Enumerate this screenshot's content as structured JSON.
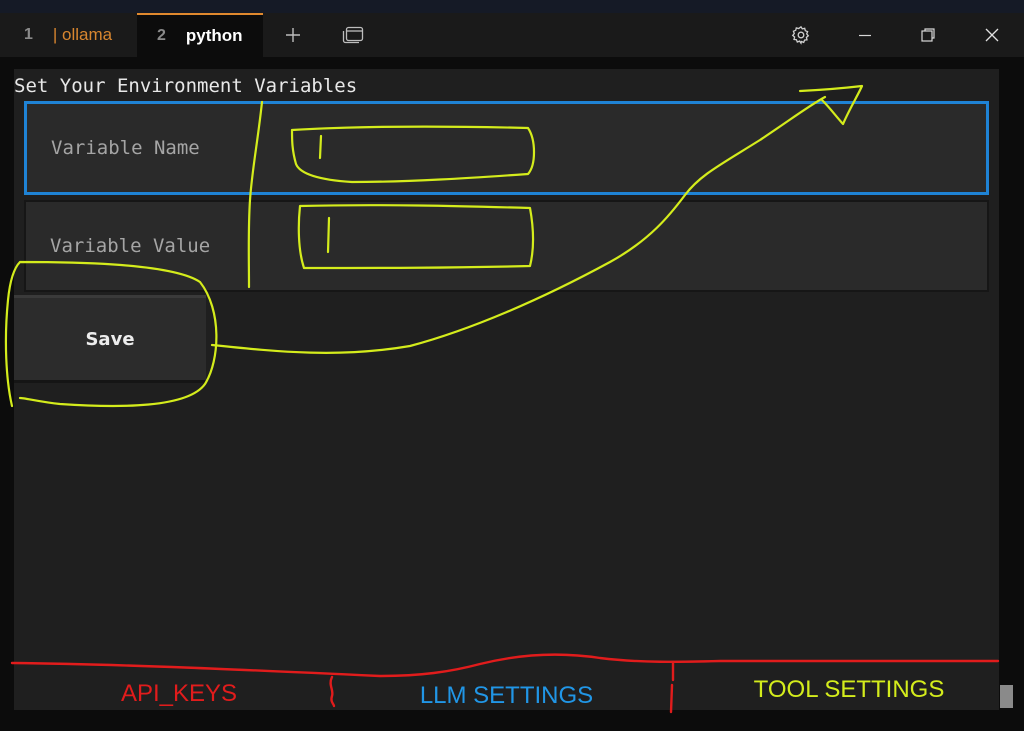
{
  "tabs": [
    {
      "number": "1",
      "title": "| ollama",
      "title_color": "#d8862f"
    },
    {
      "number": "2",
      "title": "python",
      "active": true,
      "accent": "#e0892e"
    }
  ],
  "titlebar_icons": [
    "plus-icon",
    "window-switcher-icon",
    "gear-icon",
    "minimize-icon",
    "maximize-icon",
    "close-icon"
  ],
  "form": {
    "heading": "Set Your Environment Variables",
    "name_placeholder": "Variable Name",
    "value_placeholder": "Variable Value",
    "save_label": "Save",
    "focus_color": "#1f83d5"
  },
  "bottom_tabs": [
    {
      "label": "API_KEYS",
      "color": "#e11c1c"
    },
    {
      "label": "LLM SETTINGS",
      "color": "#2196e6"
    },
    {
      "label": "TOOL SETTINGS",
      "color": "#d4ec1c"
    }
  ],
  "annotation_colors": {
    "yellow": "#d4ec1c",
    "red": "#e11c1c"
  }
}
